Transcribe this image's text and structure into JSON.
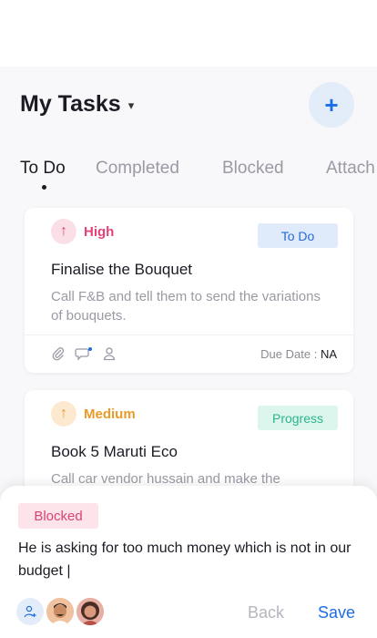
{
  "header": {
    "title": "My Tasks",
    "dropdown_icon": "chevron-down-icon"
  },
  "fab": {
    "icon": "plus-icon",
    "symbol": "+"
  },
  "tabs": [
    {
      "label": "To Do",
      "active": true
    },
    {
      "label": "Completed",
      "active": false
    },
    {
      "label": "Blocked",
      "active": false
    },
    {
      "label": "Attach",
      "active": false
    }
  ],
  "tasks": [
    {
      "priority": "High",
      "priority_icon": "arrow-up-icon",
      "status": "To Do",
      "title": "Finalise the Bouquet",
      "description": "Call F&B and tell them to send the variations of bouquets.",
      "due_label": "Due Date :",
      "due_value": "NA"
    },
    {
      "priority": "Medium",
      "priority_icon": "arrow-up-icon",
      "status": "Progress",
      "title": "Book 5 Maruti Eco",
      "description": "Call car vendor hussain and make the"
    }
  ],
  "sheet": {
    "status": "Blocked",
    "comment": "He is asking for too much money which is not in our budget |",
    "back_label": "Back",
    "save_label": "Save"
  },
  "colors": {
    "accent": "#1d6ee3",
    "high": "#e2417a",
    "medium": "#eb9a2a",
    "todo_bg": "#dfeafb",
    "progress_bg": "#dcf6ee",
    "blocked_bg": "#fce4ea"
  }
}
